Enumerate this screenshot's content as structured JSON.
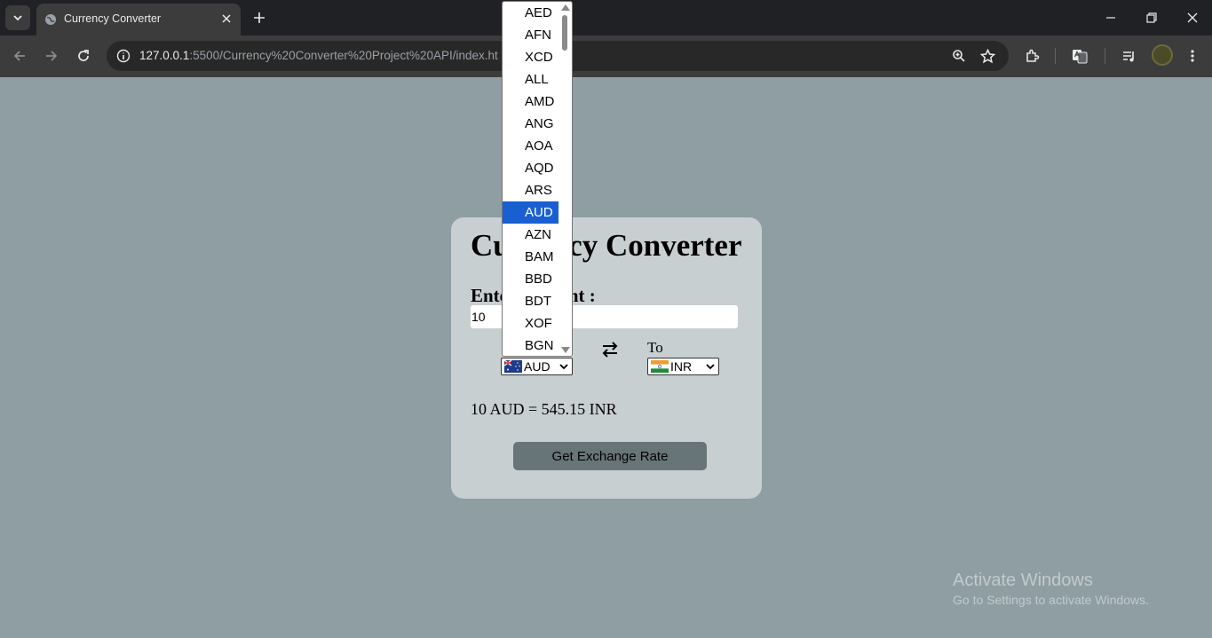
{
  "browser": {
    "tab_title": "Currency Converter",
    "url_host": "127.0.0.1",
    "url_rest": ":5500/Currency%20Converter%20Project%20API/index.ht"
  },
  "converter": {
    "title": "Currency Converter",
    "amount_label": "Enter Amount :",
    "amount_value": "10",
    "to_label": "To",
    "from_currency": "AUD",
    "to_currency": "INR",
    "result": "10 AUD = 545.15 INR",
    "button_label": "Get Exchange Rate"
  },
  "dropdown": {
    "items": [
      "AED",
      "AFN",
      "XCD",
      "ALL",
      "AMD",
      "ANG",
      "AOA",
      "AQD",
      "ARS",
      "AUD",
      "AZN",
      "BAM",
      "BBD",
      "BDT",
      "XOF",
      "BGN"
    ],
    "selected": "AUD"
  },
  "watermark": {
    "title": "Activate Windows",
    "subtitle": "Go to Settings to activate Windows."
  },
  "colors": {
    "page_bg": "#8e9ea2",
    "card_bg": "#c8cfd1",
    "button_bg": "#687578",
    "selected_item": "#1a5fd1"
  },
  "icons": [
    "tab-search-icon",
    "globe-icon",
    "close-icon",
    "plus-icon",
    "minimize-icon",
    "maximize-icon",
    "back-icon",
    "forward-icon",
    "reload-icon",
    "site-info-icon",
    "zoom-icon",
    "star-icon",
    "extensions-icon",
    "translate-icon",
    "media-icon",
    "menu-icon",
    "swap-icon",
    "australia-flag-icon",
    "india-flag-icon"
  ]
}
